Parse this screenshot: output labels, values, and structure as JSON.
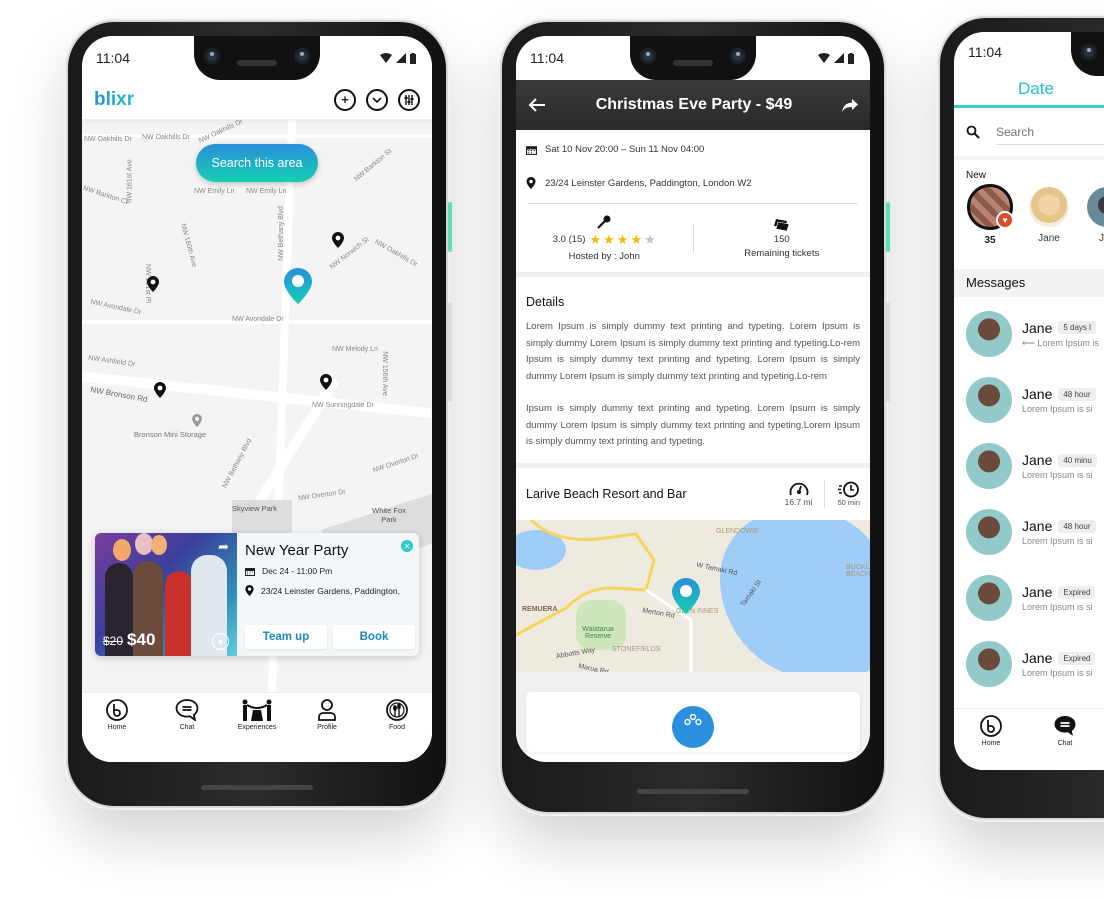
{
  "phones": [
    {
      "status_time": "11:04",
      "app_logo": "blixr",
      "header_icons": [
        "add-icon",
        "chevron-down-icon",
        "filter-icon"
      ],
      "search_area_button": "Search this area",
      "map_labels": [
        "NW Oakhills Dr",
        "NW Oakhills Dr",
        "NW Oakhills Dr",
        "NW 161st Ave",
        "NW Barkton Ct",
        "NW Emily Ln",
        "NW Emily Ln",
        "NW Bethany Blvd",
        "NW Barkton St",
        "NW 160th Ave",
        "NW 161st Pl",
        "NW Norwich St",
        "NW Oakhills Dr",
        "NW Avondale Dr",
        "NW Avondale Dr",
        "NW Melody Ln",
        "NW Ashfield Dr",
        "NW Bronson Rd",
        "NW Sunningdale Dr",
        "Bronson Mini Storage",
        "NW Bethany Blvd",
        "NW Overton Dr",
        "NW Overton Dr",
        "Skyview Park",
        "White Fox Park",
        "NW 156th Ave"
      ],
      "event_card": {
        "title": "New Year Party",
        "date": "Dec 24 - 11:00 Pm",
        "address": "23/24 Leinster Gardens, Paddington,",
        "old_price": "$20",
        "price": "$40",
        "team_up_button": "Team up",
        "book_button": "Book"
      },
      "nav": [
        {
          "label": "Home",
          "icon": "home-b-icon"
        },
        {
          "label": "Chat",
          "icon": "chat-icon"
        },
        {
          "label": "Experiences",
          "icon": "experiences-icon"
        },
        {
          "label": "Profile",
          "icon": "profile-icon"
        },
        {
          "label": "Food",
          "icon": "food-icon"
        }
      ]
    },
    {
      "status_time": "11:04",
      "header_title": "Christmas Eve Party - $49",
      "date_range": "Sat 10 Nov 20:00 – Sun 11 Nov 04:00",
      "address": "23/24 Leinster Gardens, Paddington, London W2",
      "rating_text": "3.0 (15)",
      "rating_value": 4,
      "rating_max": 5,
      "hosted_by": "Hosted by : John",
      "tickets_count": "150",
      "tickets_label": "Remaining tickets",
      "details_heading": "Details",
      "details_paragraphs": [
        "Lorem Ipsum is simply dummy text printing and typeting. Lorem Ipsum is simply dummy Lorem Ipsum is simply dummy text printing and typeting.Lo-rem Ipsum is simply dummy text printing and typeting. Lorem Ipsum is simply dummy Lorem Ipsum is simply dummy text printing and typeting.Lo-rem",
        "Ipsum is simply dummy text printing and typeting. Lorem Ipsum is simply dummy Lorem Ipsum is simply dummy text printing and typeting.Lorem Ipsum is simply dummy text printing and typeting."
      ],
      "venue_name": "Larive Beach Resort and Bar",
      "distance": "16.7 mi",
      "duration": "50 min",
      "map_labels": [
        "GLENDOWIE",
        "W Tamaki Rd",
        "REMUERA",
        "Merton Rd",
        "Waiatarua Reserve",
        "STONEFIELDS",
        "Abbotts Way",
        "Tamaki St",
        "BUCKLAND BEACH",
        "Marua Rd",
        "GLEN INNES"
      ]
    },
    {
      "status_time": "11:04",
      "title": "Date",
      "search_placeholder": "Search",
      "new_heading": "New",
      "new_items": [
        {
          "label": "35",
          "bold": true
        },
        {
          "label": "Jane"
        },
        {
          "label": "Jan"
        }
      ],
      "messages_heading": "Messages",
      "messages": [
        {
          "name": "Jane",
          "badge": "5 days l",
          "preview": "Lorem Ipsum is",
          "replied": true
        },
        {
          "name": "Jane",
          "badge": "48 hour",
          "preview": "Lorem Ipsum is si"
        },
        {
          "name": "Jane",
          "badge": "40 minu",
          "preview": "Lorem Ipsum is si"
        },
        {
          "name": "Jane",
          "badge": "48 hour",
          "preview": "Lorem Ipsum is si"
        },
        {
          "name": "Jane",
          "badge": "Expired",
          "preview": "Lorem Ipsum is si"
        },
        {
          "name": "Jane",
          "badge": "Expired",
          "preview": "Lorem Ipsum is si"
        }
      ],
      "nav": [
        {
          "label": "Home",
          "icon": "home-b-icon"
        },
        {
          "label": "Chat",
          "icon": "chat-filled-icon"
        }
      ]
    }
  ],
  "colors": {
    "accent_teal": "#1fc3c3",
    "accent_blue": "#2a8fdc",
    "header_dark": "#333333",
    "star_gold": "#f5b800",
    "side_button_green": "#5ee0b4"
  }
}
